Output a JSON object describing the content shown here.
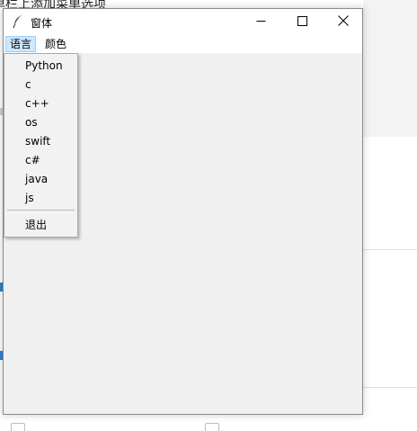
{
  "background": {
    "heading_fragment": "单栏上添加菜单选项"
  },
  "window": {
    "title": "窗体",
    "controls": {
      "minimize_icon": "minimize-icon",
      "maximize_icon": "maximize-icon",
      "close_icon": "close-icon"
    },
    "app_icon": "feather-icon"
  },
  "menubar": {
    "items": [
      {
        "label": "语言",
        "active": true
      },
      {
        "label": "颜色",
        "active": false
      }
    ]
  },
  "dropdown": {
    "items": [
      "Python",
      "c",
      "c++",
      "os",
      "swift",
      "c#",
      "java",
      "js"
    ],
    "exit_label": "退出"
  },
  "colors": {
    "menu_highlight": "#cce8ff",
    "menu_highlight_border": "#99d1ff",
    "window_bg": "#f0f0f0",
    "accent_marker": "#2f7fd6"
  }
}
